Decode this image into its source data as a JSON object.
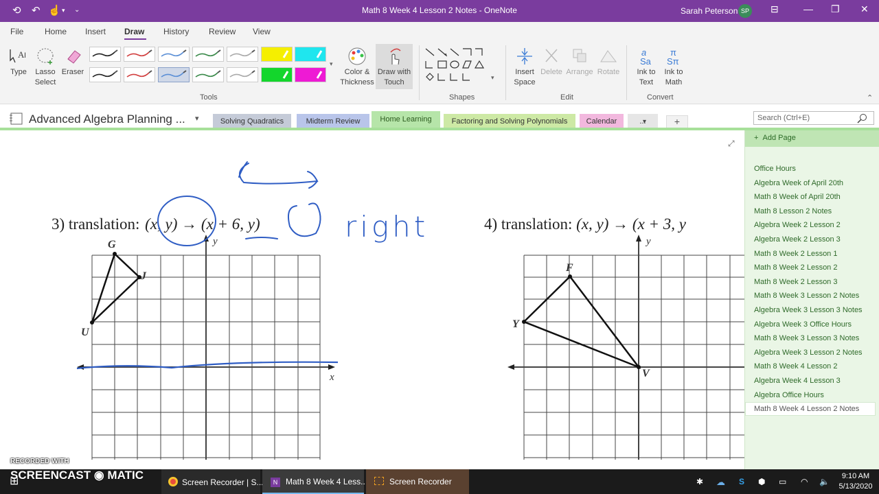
{
  "window": {
    "title": "Math 8 Week 4 Lesson 2 Notes  -  OneNote",
    "user": "Sarah Peterson",
    "initials": "SP"
  },
  "menus": [
    "File",
    "Home",
    "Insert",
    "Draw",
    "History",
    "Review",
    "View"
  ],
  "active_menu": "Draw",
  "ribbon": {
    "type_label": "Type",
    "lasso_label": "Lasso Select",
    "eraser_label": "Eraser",
    "color_label": "Color & Thickness",
    "draw_touch_label": "Draw with Touch",
    "insert_space_label": "Insert Space",
    "delete_label": "Delete",
    "arrange_label": "Arrange",
    "rotate_label": "Rotate",
    "ink_text_label": "Ink to Text",
    "ink_math_label": "Ink to Math",
    "groups": {
      "tools": "Tools",
      "shapes": "Shapes",
      "edit": "Edit",
      "convert": "Convert"
    },
    "pen_colors": [
      "#222222",
      "#d23f3f",
      "#5b8fd6",
      "#3a8a4a",
      "#aaaaaa",
      "#f5ef00",
      "#1fe6ee",
      "#222222",
      "#d23f3f",
      "#5b8fd6",
      "#3a8a4a",
      "#aaaaaa",
      "#13d62c",
      "#ee1ad4"
    ]
  },
  "notebook": {
    "name": "Advanced Algebra Planning ...",
    "tabs": [
      "Solving Quadratics",
      "Midterm Review",
      "Home Learning",
      "Factoring and Solving Polynomials",
      "Calendar",
      "..."
    ],
    "active_tab": "Home Learning",
    "tab_colors": [
      "#c5cbd8",
      "#b9c5ea",
      "#b6e5a9",
      "#cde9a5",
      "#f2b8de",
      "#e6e6e6"
    ],
    "search_placeholder": "Search (Ctrl+E)"
  },
  "page_list": {
    "add_label": "Add Page",
    "items": [
      "Office Hours",
      "Algebra Week of April 20th",
      "Math 8 Week of April 20th",
      "Math 8 Lesson 2 Notes",
      "Algebra Week 2 Lesson 2",
      "Algebra Week 2 Lesson 3",
      "Math 8 Week 2 Lesson 1",
      "Math 8 Week 2 Lesson 2",
      "Math 8 Week 2 Lesson 3",
      "Math 8 Week 3 Lesson 2 Notes",
      "Algebra Week 3 Lesson 3 Notes",
      "Algebra Week 3 Office Hours",
      "Math 8 Week 3 Lesson 3 Notes",
      "Algebra Week 3 Lesson 2 Notes",
      "Math 8 Week 4 Lesson 2",
      "Algebra Week 4 Lesson 3",
      "Algebra Office Hours",
      "Math 8 Week 4 Lesson 2 Notes"
    ],
    "selected": "Math 8 Week 4 Lesson 2 Notes"
  },
  "content": {
    "p3_num": "3)",
    "p3_word": "translation:",
    "p3_pt": "(x, y)",
    "p3_arrow": "→",
    "p3_image": "(x + 6, y)",
    "p4_num": "4)",
    "p4_word": "translation:",
    "p4_pt": "(x, y)",
    "p4_arrow": "→",
    "p4_image": "(x + 3, y",
    "axis_x": "x",
    "axis_y": "y",
    "g_label": "G",
    "j_label": "J",
    "u_label": "U",
    "f_label": "F",
    "y_label": "Y",
    "v_label": "V",
    "handwriting": "right"
  },
  "taskbar": {
    "items": [
      "Screen Recorder | S...",
      "Math 8 Week 4 Less...",
      "Screen Recorder"
    ],
    "time": "9:10 AM",
    "date": "5/13/2020"
  },
  "watermark": {
    "line1": "RECORDED WITH",
    "line2": "SCREENCAST ◉ MATIC"
  }
}
